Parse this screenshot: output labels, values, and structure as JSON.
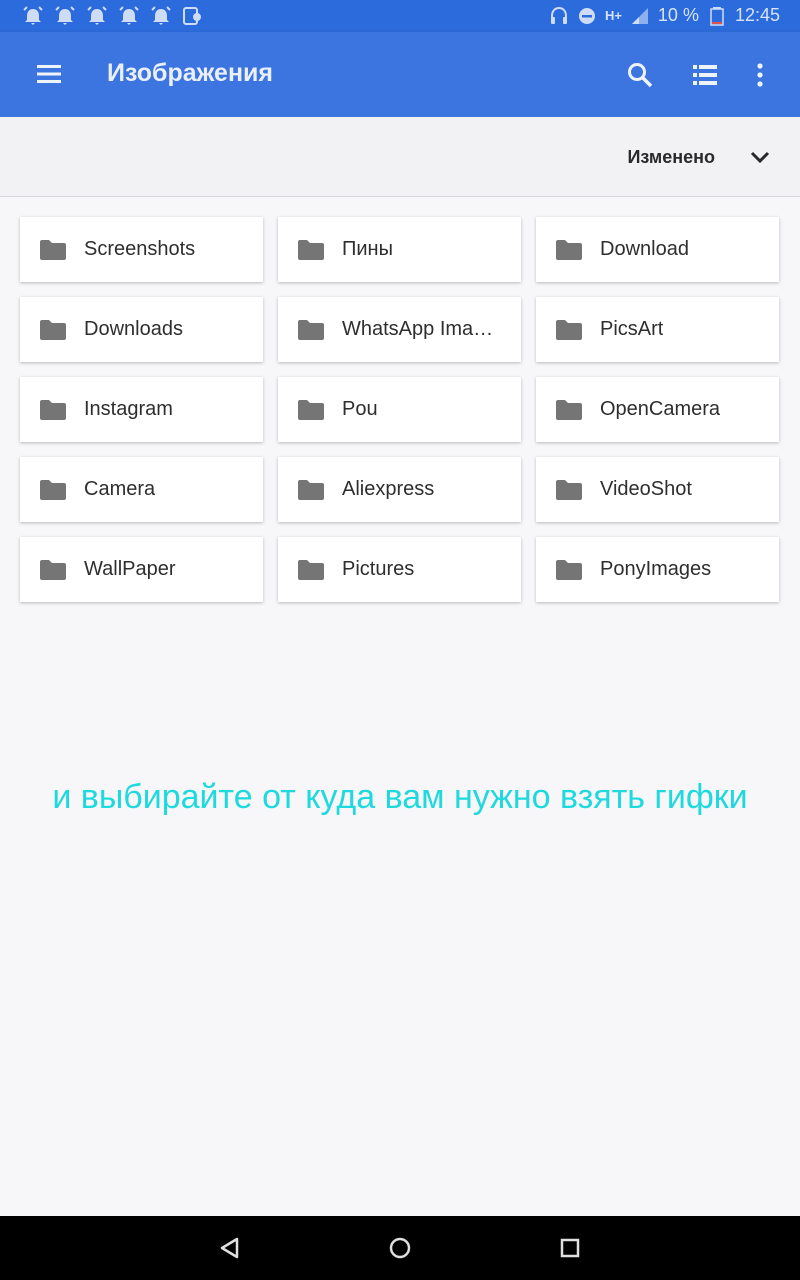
{
  "status_bar": {
    "notification_icons": [
      "alarm-icon",
      "alarm-icon",
      "alarm-icon",
      "alarm-icon",
      "alarm-icon",
      "app-notification-icon"
    ],
    "network": "H+",
    "battery": "10 %",
    "time": "12:45"
  },
  "app_bar": {
    "title": "Изображения",
    "icons": [
      "menu-icon",
      "search-icon",
      "list-view-icon",
      "more-vert-icon"
    ]
  },
  "sort": {
    "label": "Изменено"
  },
  "folders": [
    "Screenshots",
    "Пины",
    "Download",
    "Downloads",
    "WhatsApp Ima…",
    "PicsArt",
    "Instagram",
    "Pou",
    "OpenCamera",
    "Camera",
    "Aliexpress",
    "VideoShot",
    "WallPaper",
    "Pictures",
    "PonyImages"
  ],
  "caption": "и выбирайте от куда вам нужно взять гифки",
  "colors": {
    "app_bar": "#3c74e0",
    "status_bar": "#2c6bdb",
    "caption": "#1ed9dd",
    "folder_icon": "#757575"
  }
}
